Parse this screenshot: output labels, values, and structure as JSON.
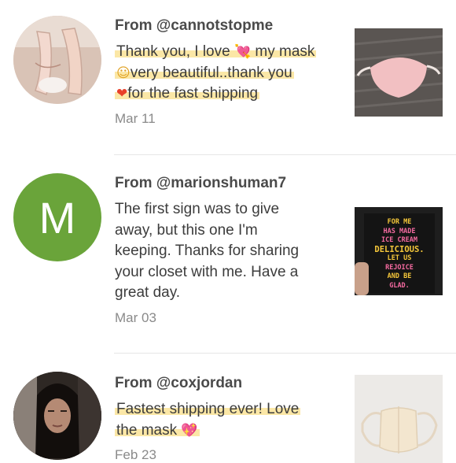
{
  "reviews": [
    {
      "from": "From @cannotstopme",
      "message_lines": [
        "Thank you, I love ",
        " my mask",
        "very beautiful..thank you",
        "for the fast shipping"
      ],
      "date": "Mar 11",
      "avatar_icon": "shoes-photo",
      "thumb_icon": "pink-mask-photo"
    },
    {
      "from": "From @marionshuman7",
      "message_lines": [
        "The first sign was to give",
        "away, but this one I'm",
        "keeping. Thanks for sharing",
        "your closet with me. Have a",
        "great day."
      ],
      "date": "Mar 03",
      "avatar_letter": "M",
      "avatar_color": "#6aa43a",
      "thumb_icon": "sign-photo",
      "thumb_text": [
        "FOR ME",
        "HAS MADE",
        "ICE CREAM",
        "DELICIOUS.",
        "LET US",
        "REJOICE",
        "AND BE",
        "GLAD."
      ]
    },
    {
      "from": "From @coxjordan",
      "message_lines": [
        "Fastest shipping ever! Love",
        "the mask"
      ],
      "date": "Feb 23",
      "avatar_icon": "woman-portrait-photo",
      "thumb_icon": "cream-mask-photo"
    }
  ],
  "highlight_color": "#fbe7a6"
}
